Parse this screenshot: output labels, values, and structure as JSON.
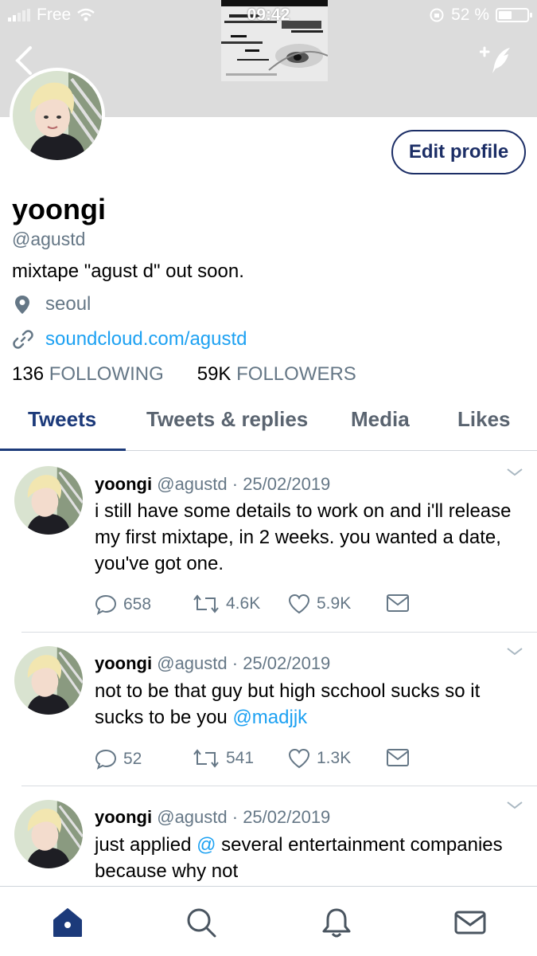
{
  "status_bar": {
    "carrier": "Free",
    "time": "09:42",
    "battery": "52 %"
  },
  "profile": {
    "name": "yoongi",
    "handle": "@agustd",
    "bio": "mixtape \"agust d\" out soon.",
    "location": "seoul",
    "link": "soundcloud.com/agustd",
    "following_count": "136",
    "following_label": "FOLLOWING",
    "followers_count": "59K",
    "followers_label": "FOLLOWERS",
    "edit_button": "Edit profile"
  },
  "tabs": [
    {
      "label": "Tweets",
      "active": true
    },
    {
      "label": "Tweets & replies",
      "active": false
    },
    {
      "label": "Media",
      "active": false
    },
    {
      "label": "Likes",
      "active": false
    }
  ],
  "tweets": [
    {
      "name": "yoongi",
      "handle": "@agustd",
      "date": "· 25/02/2019",
      "text_before": "i still have some details to work on and i'll release my first mixtape, in 2 weeks. you wanted a date, you've got one.",
      "mention": "",
      "text_after": "",
      "replies": "658",
      "retweets": "4.6K",
      "likes": "5.9K"
    },
    {
      "name": "yoongi",
      "handle": "@agustd",
      "date": "· 25/02/2019",
      "text_before": "not to be that guy but high scchool sucks so it sucks to be you ",
      "mention": "@madjjk",
      "text_after": "",
      "replies": "52",
      "retweets": "541",
      "likes": "1.3K"
    },
    {
      "name": "yoongi",
      "handle": "@agustd",
      "date": "· 25/02/2019",
      "text_before": "just applied ",
      "mention": "@",
      "text_after": " several entertainment companies because why not",
      "replies": "",
      "retweets": "",
      "likes": ""
    }
  ],
  "colors": {
    "accent": "#1c3a7a",
    "link": "#1da1f2",
    "muted": "#657786",
    "banner": "#dcdcdc"
  },
  "icons": {
    "back": "chevron-left-icon",
    "compose": "compose-feather-icon",
    "location": "location-pin-icon",
    "link": "link-icon",
    "reply": "reply-icon",
    "retweet": "retweet-icon",
    "like": "heart-icon",
    "dm": "envelope-icon",
    "home": "home-icon",
    "search": "search-icon",
    "notifications": "bell-icon",
    "messages": "mail-icon"
  }
}
